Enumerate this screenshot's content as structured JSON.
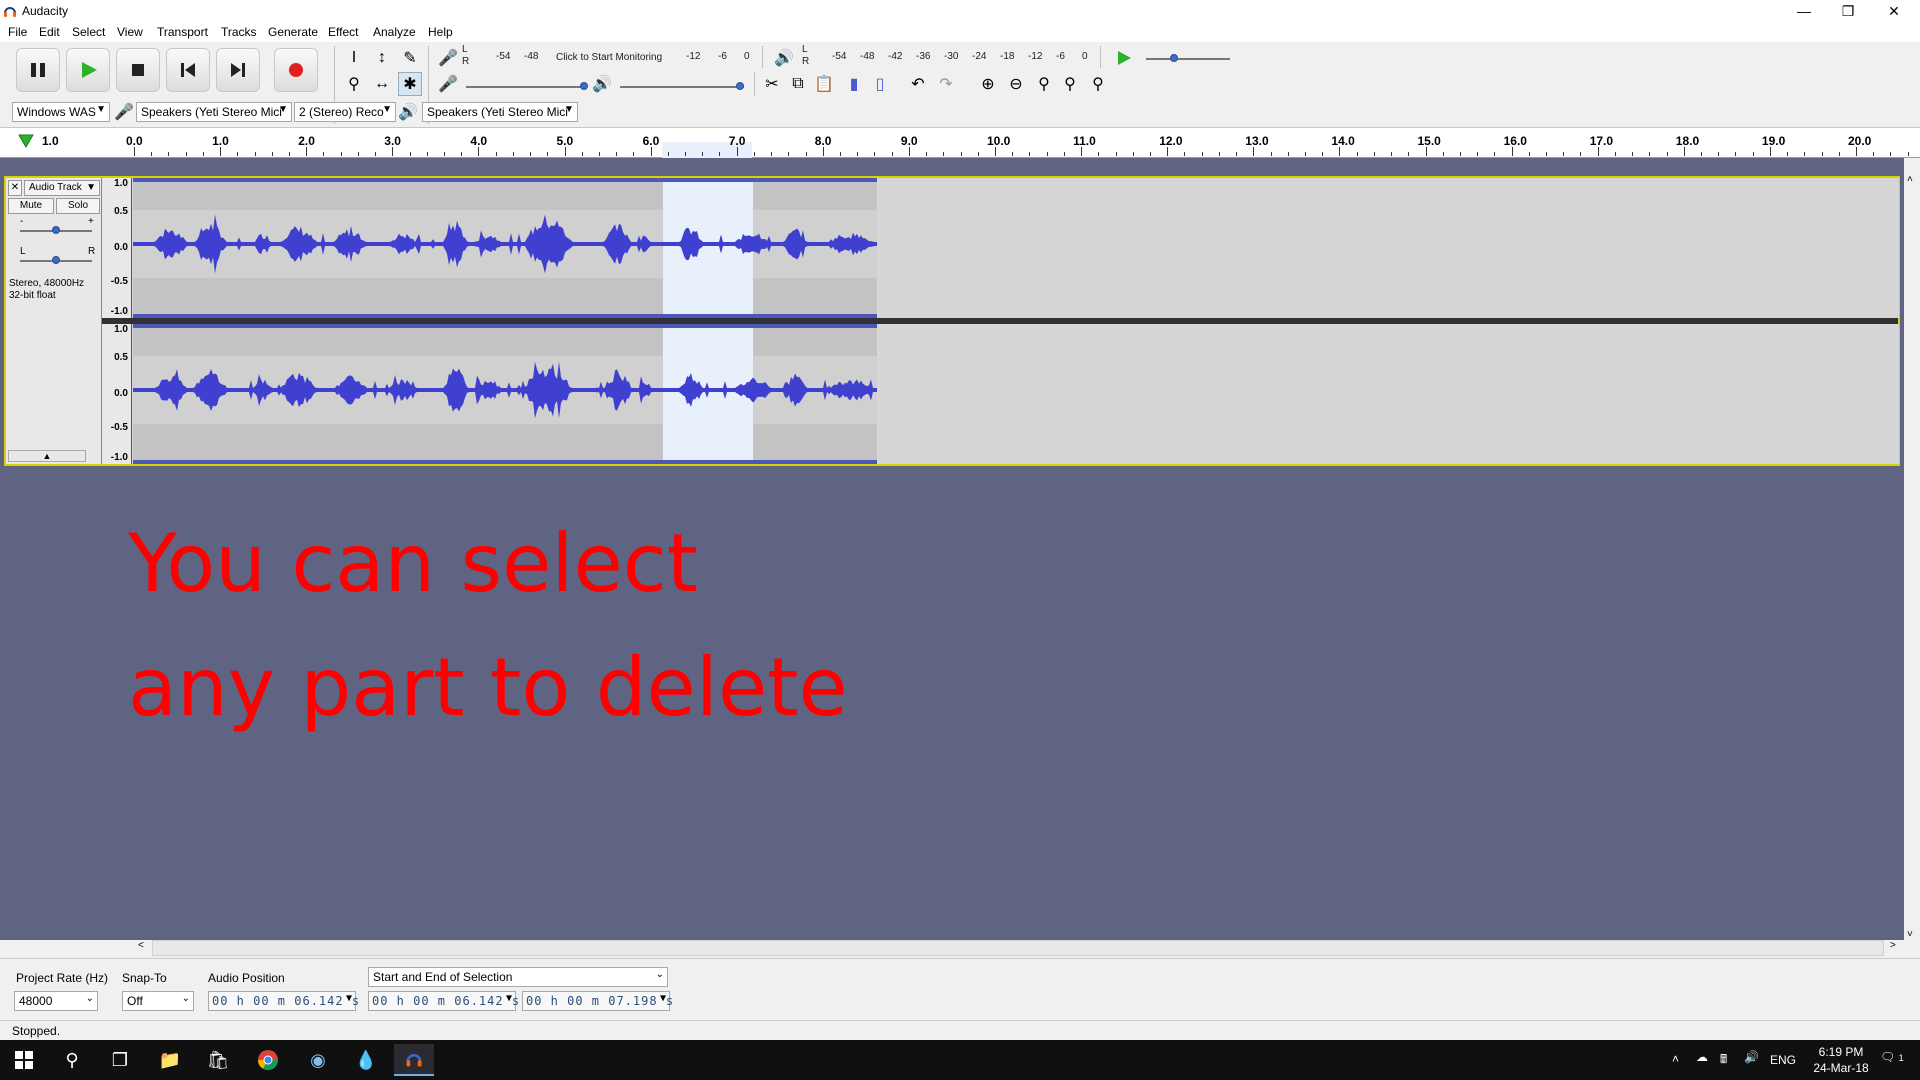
{
  "window": {
    "title": "Audacity"
  },
  "menu": [
    "File",
    "Edit",
    "Select",
    "View",
    "Transport",
    "Tracks",
    "Generate",
    "Effect",
    "Analyze",
    "Help"
  ],
  "meters": {
    "record_scale": [
      "-54",
      "-48"
    ],
    "record_prompt": "Click to Start Monitoring",
    "record_scale_end": [
      "-12",
      "-6",
      "0"
    ],
    "playback_scale": [
      "-54",
      "-48",
      "-42",
      "-36",
      "-30",
      "-24",
      "-18",
      "-12",
      "-6",
      "0"
    ],
    "lr_top": "L",
    "lr_bottom": "R"
  },
  "devices": {
    "host": "Windows WAS",
    "recording_device": "Speakers (Yeti Stereo Mici",
    "channels": "2 (Stereo) Reco",
    "playback_device": "Speakers (Yeti Stereo Mici"
  },
  "ruler": {
    "start": "1.0",
    "labels": [
      "0.0",
      "1.0",
      "2.0",
      "3.0",
      "4.0",
      "5.0",
      "6.0",
      "7.0",
      "8.0",
      "9.0",
      "10.0",
      "11.0",
      "12.0",
      "13.0",
      "14.0",
      "15.0",
      "16.0",
      "17.0",
      "18.0",
      "19.0",
      "20.0"
    ]
  },
  "track": {
    "name": "Audio Track",
    "mute": "Mute",
    "solo": "Solo",
    "gain_minus": "-",
    "gain_plus": "+",
    "pan_left": "L",
    "pan_right": "R",
    "info_line1": "Stereo, 48000Hz",
    "info_line2": "32-bit float",
    "vruler": [
      "1.0",
      "0.5",
      "0.0",
      "-0.5",
      "-1.0"
    ]
  },
  "overlay": {
    "line1": "You can select",
    "line2": "any part to delete"
  },
  "selection_bar": {
    "project_rate_label": "Project Rate (Hz)",
    "project_rate": "48000",
    "snap_to_label": "Snap-To",
    "snap_to": "Off",
    "audio_position_label": "Audio Position",
    "audio_position": "00 h 00 m 06.142 s",
    "selection_mode": "Start and End of Selection",
    "selection_start": "00 h 00 m 06.142 s",
    "selection_end": "00 h 00 m 07.198 s"
  },
  "status": {
    "text": "Stopped."
  },
  "taskbar": {
    "language": "ENG",
    "time": "6:19 PM",
    "date": "24-Mar-18",
    "notifications": "1"
  },
  "colors": {
    "waveform": "#3f3fd0",
    "selection": "#e8f0fb",
    "overlay_text": "#ff0000",
    "track_border": "#d8d200"
  }
}
